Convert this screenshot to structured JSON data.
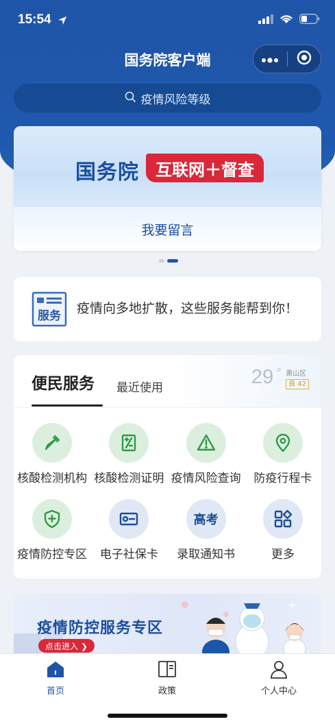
{
  "status_bar": {
    "time": "15:54"
  },
  "header": {
    "title": "国务院客户端"
  },
  "search": {
    "placeholder": "疫情风险等级"
  },
  "banner": {
    "main_text": "国务院",
    "pill_text": "互联网＋督查",
    "link_text": "我要留言"
  },
  "notice": {
    "icon_text": "服务",
    "text": "疫情向多地扩散，这些服务能帮到你！"
  },
  "services": {
    "tab_active": "便民服务",
    "tab_recent": "最近使用",
    "weather": {
      "temp": "29",
      "unit": "°",
      "district": "萧山区",
      "aqi": "良 42"
    },
    "items": [
      {
        "label": "核酸检测机构",
        "icon": "dropper-icon"
      },
      {
        "label": "核酸检测证明",
        "icon": "certificate-icon"
      },
      {
        "label": "疫情风险查询",
        "icon": "warning-icon"
      },
      {
        "label": "防疫行程卡",
        "icon": "location-icon"
      },
      {
        "label": "疫情防控专区",
        "icon": "shield-plus-icon"
      },
      {
        "label": "电子社保卡",
        "icon": "id-card-icon"
      },
      {
        "label": "录取通知书",
        "icon": "gaokao-icon",
        "icon_text": "高考"
      },
      {
        "label": "更多",
        "icon": "grid-icon"
      }
    ]
  },
  "promo": {
    "title": "疫情防控服务专区",
    "button": "点击进入 ❯"
  },
  "tabbar": {
    "items": [
      {
        "label": "首页"
      },
      {
        "label": "政策"
      },
      {
        "label": "个人中心"
      }
    ]
  },
  "colors": {
    "brand_blue": "#1f55a8",
    "accent_red": "#d9283a",
    "service_green": "#2f9a43"
  }
}
